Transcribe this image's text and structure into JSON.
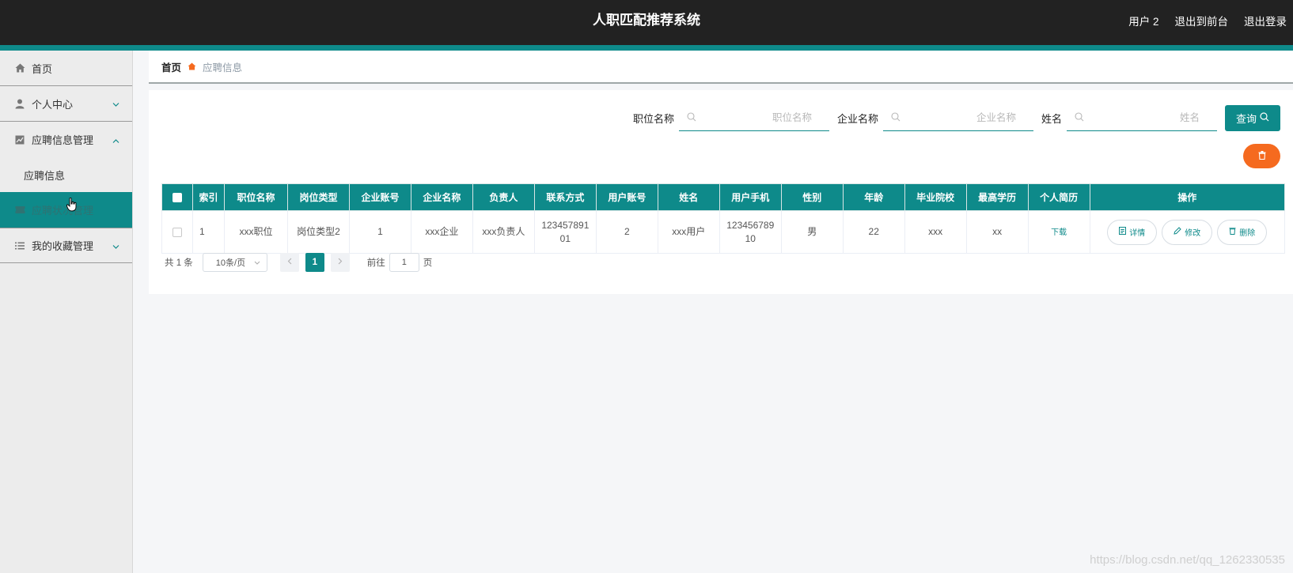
{
  "header": {
    "title": "人职匹配推荐系统",
    "user": "用户 2",
    "to_front": "退出到前台",
    "logout": "退出登录"
  },
  "sidebar": {
    "items": [
      {
        "label": "首页",
        "icon": "home-icon"
      },
      {
        "label": "个人中心",
        "icon": "user-icon"
      },
      {
        "label": "应聘信息管理",
        "icon": "chart-icon"
      },
      {
        "label": "应聘信息"
      },
      {
        "label": "应聘状况管理",
        "icon": "ticket-icon"
      },
      {
        "label": "我的收藏管理",
        "icon": "list-icon"
      }
    ]
  },
  "breadcrumb": {
    "home": "首页",
    "current": "应聘信息"
  },
  "search": {
    "position_label": "职位名称",
    "position_placeholder": "职位名称",
    "company_label": "企业名称",
    "company_placeholder": "企业名称",
    "name_label": "姓名",
    "name_placeholder": "姓名",
    "query_button": "查询"
  },
  "table": {
    "headers": [
      "索引",
      "职位名称",
      "岗位类型",
      "企业账号",
      "企业名称",
      "负责人",
      "联系方式",
      "用户账号",
      "姓名",
      "用户手机",
      "性别",
      "年龄",
      "毕业院校",
      "最高学历",
      "个人简历",
      "操作"
    ],
    "rows": [
      {
        "index": "1",
        "position": "xxx职位",
        "post_type": "岗位类型2",
        "company_account": "1",
        "company_name": "xxx企业",
        "manager": "xxx负责人",
        "contact": "12345789101",
        "contact_l1": "123457891",
        "contact_l2": "01",
        "user_account": "2",
        "name": "xxx用户",
        "phone_l1": "123456789",
        "phone_l2": "10",
        "gender": "男",
        "age": "22",
        "school": "xxx",
        "degree": "xx",
        "resume": "下载",
        "ops": {
          "detail": "详情",
          "edit": "修改",
          "delete": "删除"
        }
      }
    ]
  },
  "pagination": {
    "total": "共 1 条",
    "page_size": "10条/页",
    "current_page": "1",
    "goto_label": "前往",
    "goto_value": "1",
    "page_unit": "页"
  },
  "watermark": "https://blog.csdn.net/qq_1262330535",
  "colors": {
    "accent": "#0e8a8a",
    "header_bg": "#222222",
    "danger": "#f56a1f"
  }
}
